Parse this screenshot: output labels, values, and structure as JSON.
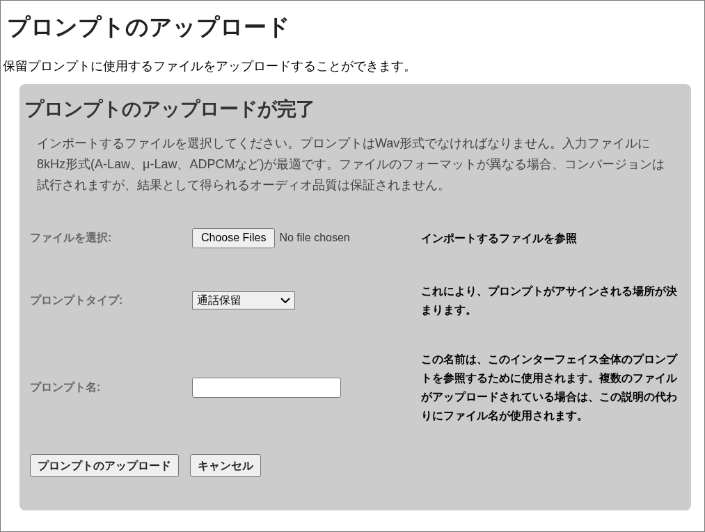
{
  "page": {
    "title": "プロンプトのアップロード",
    "intro": "保留プロンプトに使用するファイルをアップロードすることができます。"
  },
  "panel": {
    "title": "プロンプトのアップロードが完了",
    "description": "インポートするファイルを選択してください。プロンプトはWav形式でなければなりません。入力ファイルに8kHz形式(A-Law、μ-Law、ADPCMなど)が最適です。ファイルのフォーマットが異なる場合、コンバージョンは試行されますが、結果として得られるオーディオ品質は保証されません。",
    "fields": [
      {
        "kind": "file",
        "label": "ファイルを選択:",
        "button": "Choose Files",
        "status": "No file chosen",
        "help": "インポートするファイルを参照"
      },
      {
        "kind": "select",
        "label": "プロンプトタイプ:",
        "value": "通話保留",
        "help": "これにより、プロンプトがアサインされる場所が決まります。"
      },
      {
        "kind": "text",
        "label": "プロンプト名:",
        "help": "この名前は、このインターフェイス全体のプロンプトを参照するために使用されます。複数のファイルがアップロードされている場合は、この説明の代わりにファイル名が使用されます。"
      }
    ],
    "buttons": [
      "プロンプトのアップロード",
      "キャンセル"
    ]
  }
}
